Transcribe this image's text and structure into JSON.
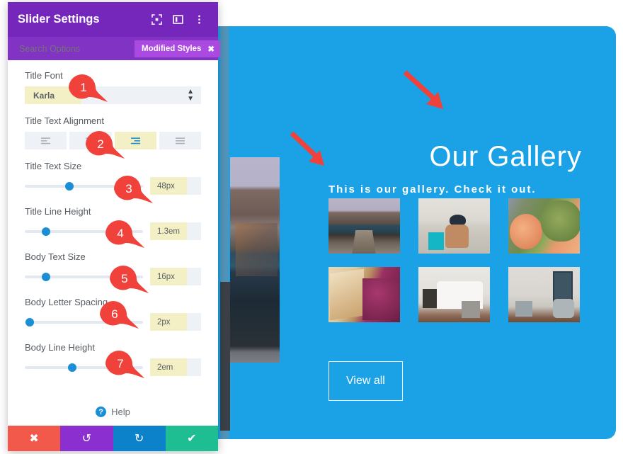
{
  "colors": {
    "panel_header": "#7627bb",
    "panel_search": "#8133c4",
    "badge": "#ab4ae0",
    "preview_bg": "#1ba2e6",
    "accent_blue": "#1a8fd6",
    "highlight_yellow": "#f2f0c4",
    "field_grey": "#eef1f6",
    "annotation_red": "#f0413a",
    "action_cancel": "#f2594b",
    "action_undo": "#8b2fd0",
    "action_redo": "#0c82ca",
    "action_save": "#1fbd92"
  },
  "panel": {
    "title": "Slider Settings",
    "header_icons": [
      {
        "name": "focus-target-icon",
        "glyph": "focus"
      },
      {
        "name": "layout-panel-icon",
        "glyph": "layout"
      },
      {
        "name": "more-options-icon",
        "glyph": "dots"
      }
    ],
    "search": {
      "placeholder": "Search Options",
      "value": ""
    },
    "modified_styles": {
      "label": "Modified Styles",
      "close_glyph": "✖"
    },
    "fields": [
      {
        "name": "title-font",
        "label": "Title Font",
        "type": "select",
        "value": "Karla",
        "bubble": "1"
      },
      {
        "name": "title-text-alignment",
        "label": "Title Text Alignment",
        "type": "alignment",
        "options": [
          "left",
          "center",
          "right",
          "justify"
        ],
        "selected_index": 2,
        "bubble": "2"
      },
      {
        "name": "title-text-size",
        "label": "Title Text Size",
        "type": "slider",
        "value": "48px",
        "thumb_percent": 38,
        "bubble": "3"
      },
      {
        "name": "title-line-height",
        "label": "Title Line Height",
        "type": "slider",
        "value": "1.3em",
        "thumb_percent": 18,
        "bubble": "4"
      },
      {
        "name": "body-text-size",
        "label": "Body Text Size",
        "type": "slider",
        "value": "16px",
        "thumb_percent": 18,
        "bubble": "5"
      },
      {
        "name": "body-letter-spacing",
        "label": "Body Letter Spacing",
        "type": "slider",
        "value": "2px",
        "thumb_percent": 4,
        "bubble": "6"
      },
      {
        "name": "body-line-height",
        "label": "Body Line Height",
        "type": "slider",
        "value": "2em",
        "thumb_percent": 40,
        "bubble": "7"
      }
    ],
    "help": {
      "label": "Help",
      "icon_glyph": "?"
    },
    "actions": [
      {
        "name": "cancel-button",
        "glyph": "✖"
      },
      {
        "name": "undo-button",
        "glyph": "↺"
      },
      {
        "name": "redo-button",
        "glyph": "↻"
      },
      {
        "name": "save-button",
        "glyph": "✔"
      }
    ]
  },
  "preview": {
    "title": "Our Gallery",
    "subtitle": "This is our gallery. Check it out.",
    "view_all_label": "View all",
    "gallery": {
      "rows": [
        [
          {
            "name": "thumb-dock-mountain-lake"
          },
          {
            "name": "thumb-person-reading-hat"
          },
          {
            "name": "thumb-peaches-artichokes"
          }
        ],
        [
          {
            "name": "thumb-produce-crates"
          },
          {
            "name": "thumb-white-bedroom"
          },
          {
            "name": "thumb-living-room-mirror"
          }
        ]
      ]
    }
  }
}
